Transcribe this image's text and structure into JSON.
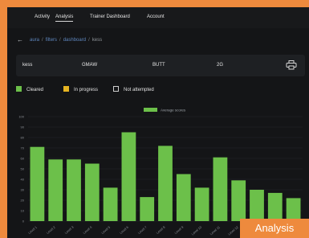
{
  "nav": {
    "tabs": [
      {
        "label": "Activity"
      },
      {
        "label": "Analysis",
        "active": true
      },
      {
        "label": "Trainer Dashboard"
      },
      {
        "label": "Account"
      }
    ]
  },
  "breadcrumb": {
    "items": [
      "aura",
      "filters",
      "dashboard",
      "kess"
    ]
  },
  "filters": {
    "name": "kess",
    "process": "GMAW",
    "joint": "BUTT",
    "position": "2G"
  },
  "legend": {
    "items": [
      {
        "label": "Cleared",
        "color": "#6cc04a"
      },
      {
        "label": "In progress",
        "color": "#e6b422"
      },
      {
        "label": "Not attempted",
        "color": "#141517"
      }
    ]
  },
  "chart_data": {
    "type": "bar",
    "series": [
      {
        "name": "Average scores",
        "color": "#6cc04a",
        "values": [
          71,
          59,
          59,
          55,
          32,
          85,
          23,
          72,
          45,
          32,
          61,
          39,
          30,
          27,
          22
        ]
      }
    ],
    "categories": [
      "Level 1",
      "Level 2",
      "Level 3",
      "Level 4",
      "Level 5",
      "Level 6",
      "Level 7",
      "Level 8",
      "Level 9",
      "Level 10",
      "Level 11",
      "Level 12",
      "Level 13",
      "Level 14",
      "Level 15"
    ],
    "y_ticks": [
      0,
      10,
      20,
      30,
      40,
      50,
      60,
      70,
      80,
      90,
      100
    ],
    "ylim": [
      0,
      100
    ],
    "grid": true,
    "legend_position": "top-center"
  },
  "badge": {
    "label": "Analysis"
  }
}
